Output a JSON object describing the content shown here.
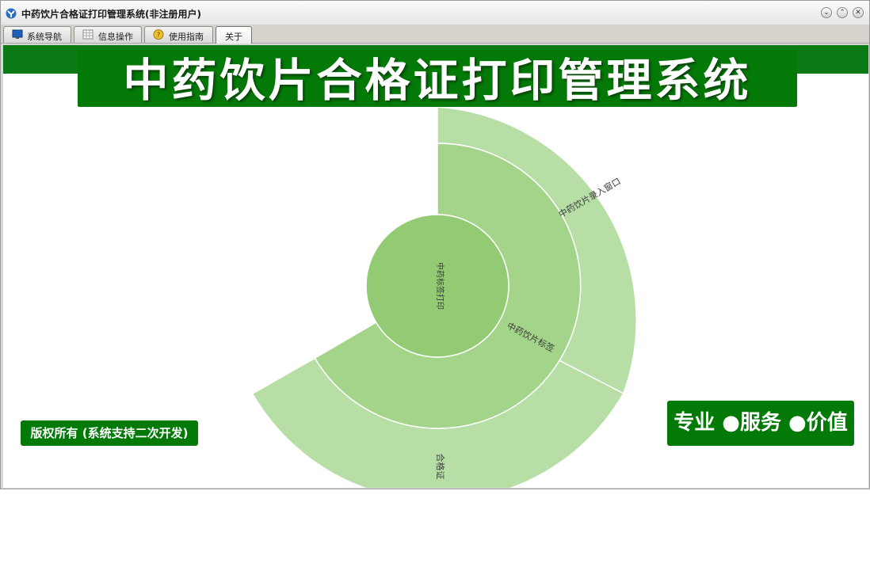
{
  "window": {
    "title": "中药饮片合格证打印管理系统(非注册用户)",
    "controls": {
      "minimize": "⌄",
      "maximize": "⌃",
      "close": "✕"
    }
  },
  "tabs": [
    {
      "label": "系统导航",
      "icon": "monitor-icon",
      "active": false
    },
    {
      "label": "信息操作",
      "icon": "grid-icon",
      "active": false
    },
    {
      "label": "使用指南",
      "icon": "guide-icon",
      "active": false
    },
    {
      "label": "关于",
      "icon": "",
      "active": true
    }
  ],
  "banner": {
    "title": "中药饮片合格证打印管理系统"
  },
  "sunburst": {
    "center_label": "中药标签打印",
    "middle_label": "中药饮片标签",
    "outer_labels": [
      "中药饮片录入窗口",
      "合格证"
    ]
  },
  "footer": {
    "copyright": "版权所有 (系统支持二次开发)",
    "slogan": "专业 ●服务 ●价值"
  },
  "colors": {
    "brand_green": "#037a07",
    "ring_inner": "#93ca74",
    "ring_middle": "#a3d48a",
    "ring_outer": "#b6dea5"
  }
}
